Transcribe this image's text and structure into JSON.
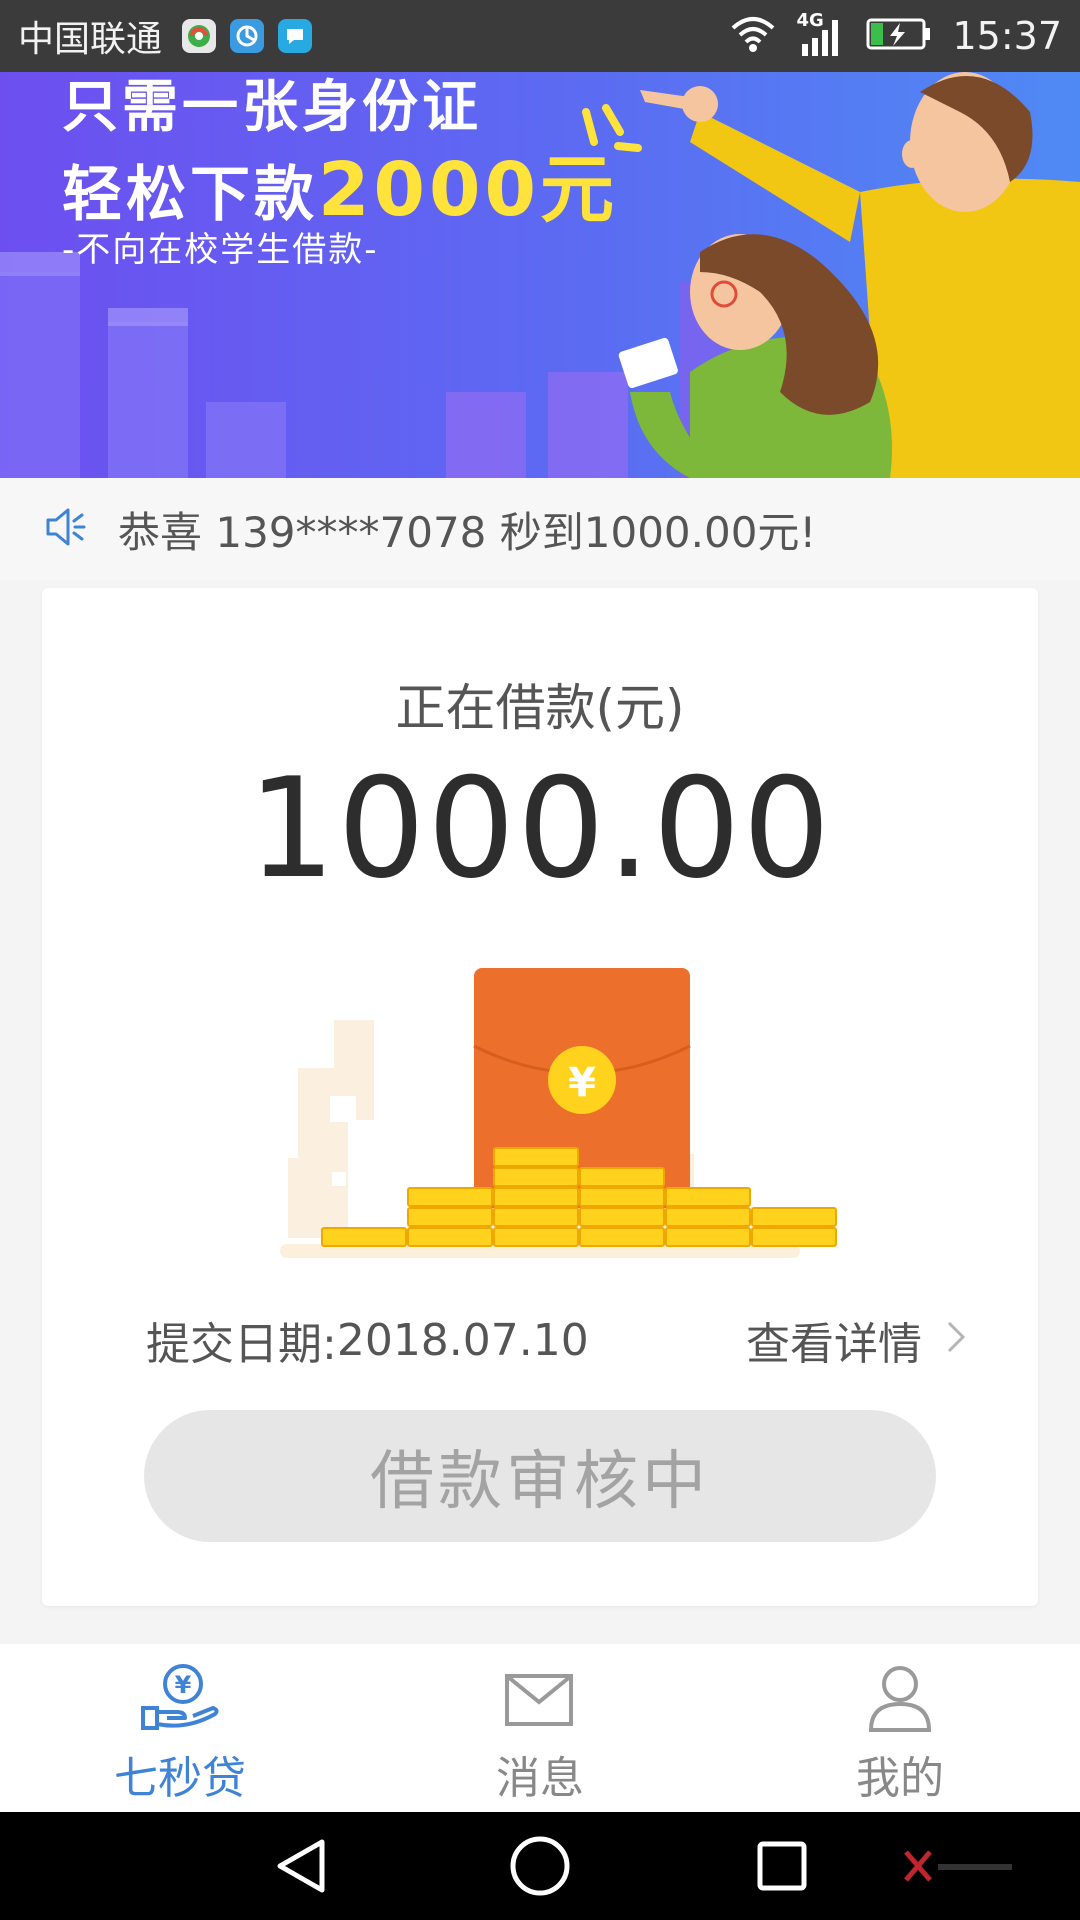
{
  "status_bar": {
    "carrier": "中国联通",
    "network": "4G",
    "time": "15:37"
  },
  "banner": {
    "line1": "只需一张身份证",
    "line2_prefix": "轻松下款",
    "line2_highlight": "2000元",
    "line3": "-不向在校学生借款-"
  },
  "notice": {
    "text": "恭喜 139****7078 秒到1000.00元!"
  },
  "loan": {
    "label": "正在借款(元)",
    "amount": "1000.00",
    "submit_label": "提交日期:",
    "submit_date": "2018.07.10",
    "detail_link": "查看详情",
    "status": "借款审核中"
  },
  "bottom_nav": {
    "items": [
      {
        "label": "七秒贷",
        "icon": "loan-hand-icon",
        "active": true
      },
      {
        "label": "消息",
        "icon": "envelope-icon",
        "active": false
      },
      {
        "label": "我的",
        "icon": "user-icon",
        "active": false
      }
    ]
  },
  "colors": {
    "accent": "#3f83d6",
    "banner_highlight": "#ffe23a",
    "envelope": "#ec6f2b",
    "coin": "#ffd21e"
  }
}
